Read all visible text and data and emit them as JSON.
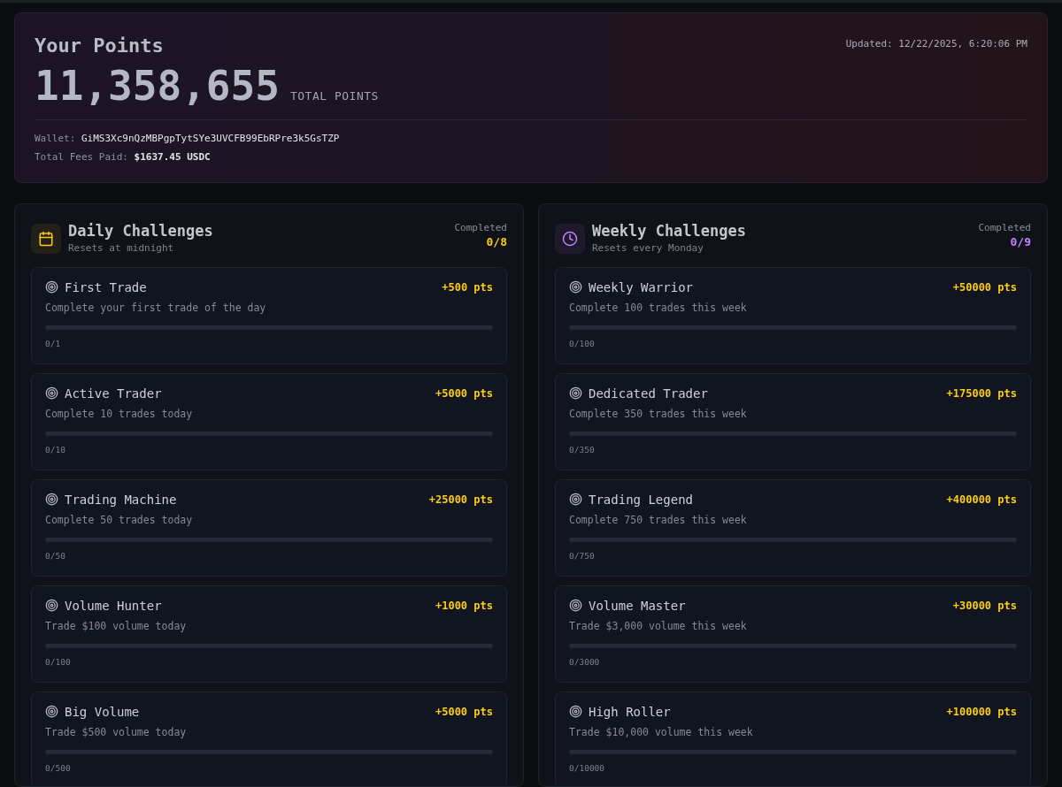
{
  "points": {
    "title": "Your Points",
    "updated": "Updated: 12/22/2025, 6:20:06 PM",
    "total": "11,358,655",
    "total_label": "TOTAL POINTS",
    "wallet_label": "Wallet:",
    "wallet": "GiMS3Xc9nQzMBPgpTytSYe3UVCFB99EbRPre3k5GsTZP",
    "fees_label": "Total Fees Paid:",
    "fees": "$1637.45 USDC"
  },
  "sections": [
    {
      "kind": "daily",
      "color": "#facc15",
      "title": "Daily Challenges",
      "subtitle": "Resets at midnight",
      "completed_label": "Completed",
      "completed": "0/8",
      "challenges": [
        {
          "title": "First Trade",
          "reward": "+500 pts",
          "description": "Complete your first trade of the day",
          "level": 0,
          "progress": "0/1"
        },
        {
          "title": "Active Trader",
          "reward": "+5000 pts",
          "description": "Complete 10 trades today",
          "level": 0,
          "progress": "0/10"
        },
        {
          "title": "Trading Machine",
          "reward": "+25000 pts",
          "description": "Complete 50 trades today",
          "level": 0,
          "progress": "0/50"
        },
        {
          "title": "Volume Hunter",
          "reward": "+1000 pts",
          "description": "Trade $100 volume today",
          "level": 0,
          "progress": "0/100"
        },
        {
          "title": "Big Volume",
          "reward": "+5000 pts",
          "description": "Trade $500 volume today",
          "level": 0,
          "progress": "0/500"
        }
      ]
    },
    {
      "kind": "weekly",
      "color": "#c084fc",
      "title": "Weekly Challenges",
      "subtitle": "Resets every Monday",
      "completed_label": "Completed",
      "completed": "0/9",
      "challenges": [
        {
          "title": "Weekly Warrior",
          "reward": "+50000 pts",
          "description": "Complete 100 trades this week",
          "level": 0,
          "progress": "0/100"
        },
        {
          "title": "Dedicated Trader",
          "reward": "+175000 pts",
          "description": "Complete 350 trades this week",
          "level": 0,
          "progress": "0/350"
        },
        {
          "title": "Trading Legend",
          "reward": "+400000 pts",
          "description": "Complete 750 trades this week",
          "level": 0,
          "progress": "0/750"
        },
        {
          "title": "Volume Master",
          "reward": "+30000 pts",
          "description": "Trade $3,000 volume this week",
          "level": 0,
          "progress": "0/3000"
        },
        {
          "title": "High Roller",
          "reward": "+100000 pts",
          "description": "Trade $10,000 volume this week",
          "level": 0,
          "progress": "0/10000"
        }
      ]
    }
  ]
}
